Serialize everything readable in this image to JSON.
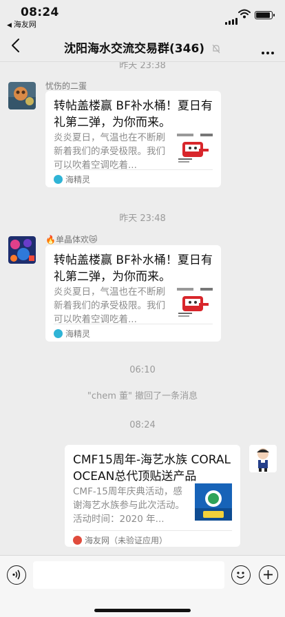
{
  "status": {
    "time": "08:24",
    "back_app": "海友网",
    "back_glyph": "◀"
  },
  "nav": {
    "title": "沈阳海水交流交易群(346)",
    "back_icon": "chevron-left-icon",
    "mute_icon": "bell-muted-icon",
    "more_icon": "more-icon"
  },
  "messages": {
    "ts_top": "昨天 23:38",
    "msg1": {
      "sender": "忧伤的二蛋",
      "title": "转帖盖楼赢 BF补水桶！夏日有礼第二弹，为你而来。",
      "desc": "炎炎夏日，气温也在不断刷新着我们的承受极限。我们可以吹着空调吃着...",
      "source": "海精灵"
    },
    "ts2": "昨天 23:48",
    "msg2": {
      "sender": "🔥单晶体欢😿",
      "title": "转帖盖楼赢 BF补水桶！夏日有礼第二弹，为你而来。",
      "desc": "炎炎夏日，气温也在不断刷新着我们的承受极限。我们可以吹着空调吃着...",
      "source": "海精灵"
    },
    "ts3": "06:10",
    "recall": "\"chem 董\" 撤回了一条消息",
    "ts4": "08:24",
    "msg3": {
      "title": "CMF15周年-海艺水族 CORAL OCEAN总代顶贴送产品",
      "desc": "CMF-15周年庆典活动，感谢海艺水族参与此次活动。活动时间：2020 年...",
      "source": "海友网（未验证应用）"
    }
  },
  "input": {
    "voice_icon": "voice-icon",
    "emoji_icon": "emoji-icon",
    "plus_icon": "plus-icon"
  },
  "colors": {
    "background": "#ededed",
    "card": "#ffffff",
    "timestamp": "#9a9a9a",
    "source_icon": "#2fb4d6"
  }
}
